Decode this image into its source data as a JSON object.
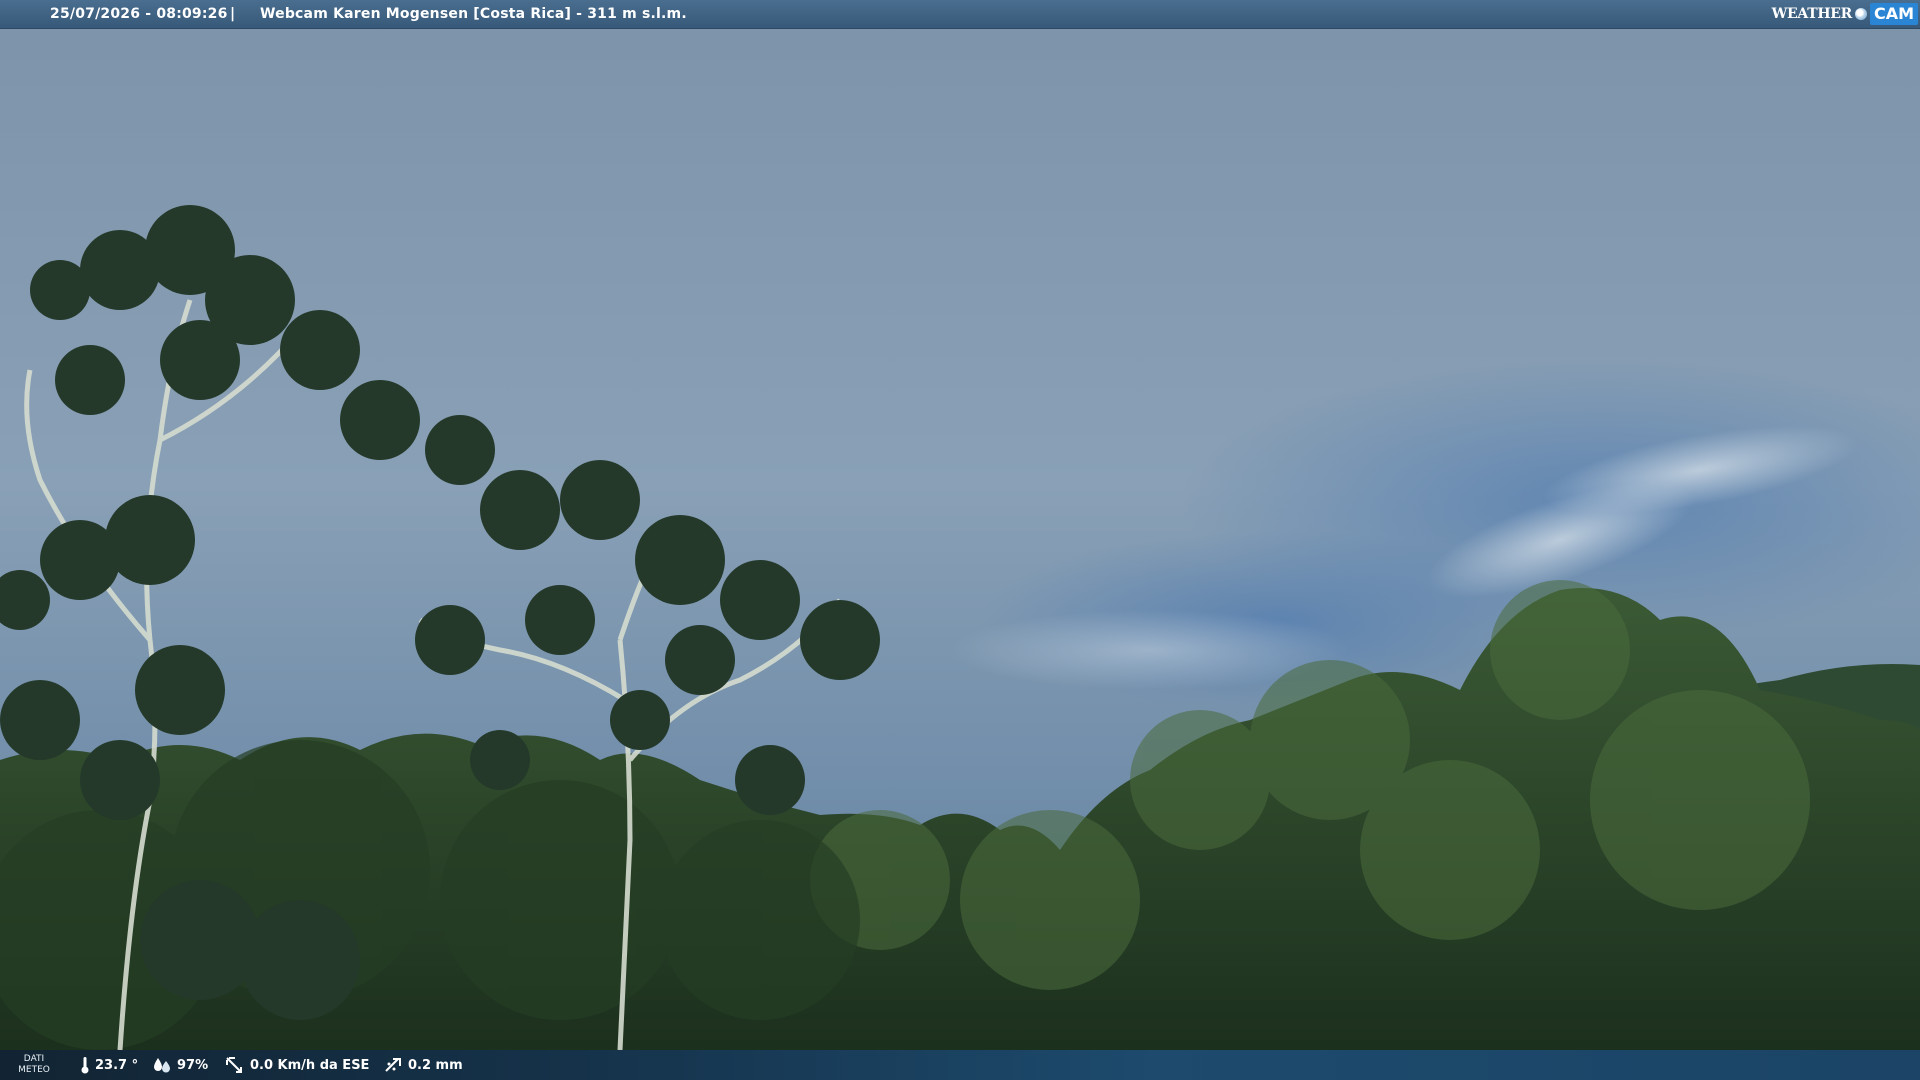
{
  "header": {
    "datetime": "25/07/2026 - 08:09:26",
    "separator": "|",
    "title": "Webcam Karen Mogensen [Costa Rica] - 311 m s.l.m."
  },
  "logo": {
    "weather": "WEATHER",
    "cam": "CAM"
  },
  "weather_bar": {
    "label_line1": "DATI",
    "label_line2": "METEO",
    "temperature": "23.7 °",
    "humidity": "97%",
    "wind": "0.0 Km/h da ESE",
    "rain": "0.2 mm"
  },
  "colors": {
    "sky_top": "#7f95ab",
    "sky_bottom": "#6b89a7",
    "forest": "#2e4a2c",
    "header_bg": "#3f6486",
    "footer_bg": "#15324a"
  }
}
